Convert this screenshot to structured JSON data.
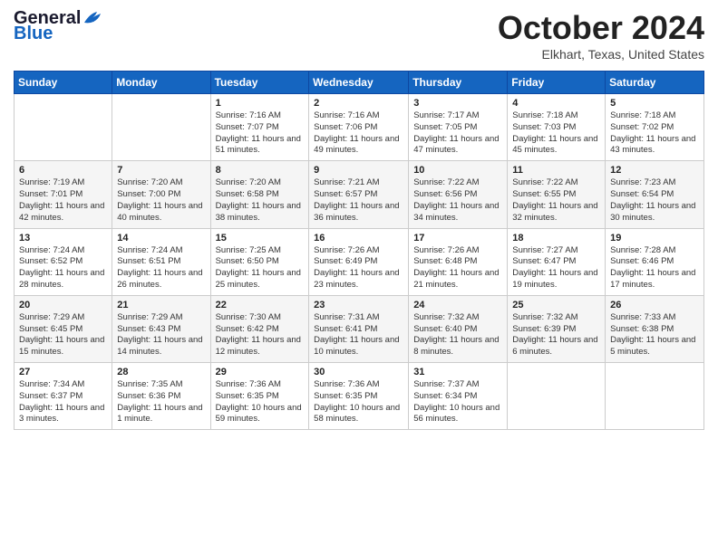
{
  "logo": {
    "line1": "General",
    "line2": "Blue"
  },
  "title": "October 2024",
  "location": "Elkhart, Texas, United States",
  "weekdays": [
    "Sunday",
    "Monday",
    "Tuesday",
    "Wednesday",
    "Thursday",
    "Friday",
    "Saturday"
  ],
  "weeks": [
    [
      {
        "day": "",
        "info": ""
      },
      {
        "day": "",
        "info": ""
      },
      {
        "day": "1",
        "info": "Sunrise: 7:16 AM\nSunset: 7:07 PM\nDaylight: 11 hours and 51 minutes."
      },
      {
        "day": "2",
        "info": "Sunrise: 7:16 AM\nSunset: 7:06 PM\nDaylight: 11 hours and 49 minutes."
      },
      {
        "day": "3",
        "info": "Sunrise: 7:17 AM\nSunset: 7:05 PM\nDaylight: 11 hours and 47 minutes."
      },
      {
        "day": "4",
        "info": "Sunrise: 7:18 AM\nSunset: 7:03 PM\nDaylight: 11 hours and 45 minutes."
      },
      {
        "day": "5",
        "info": "Sunrise: 7:18 AM\nSunset: 7:02 PM\nDaylight: 11 hours and 43 minutes."
      }
    ],
    [
      {
        "day": "6",
        "info": "Sunrise: 7:19 AM\nSunset: 7:01 PM\nDaylight: 11 hours and 42 minutes."
      },
      {
        "day": "7",
        "info": "Sunrise: 7:20 AM\nSunset: 7:00 PM\nDaylight: 11 hours and 40 minutes."
      },
      {
        "day": "8",
        "info": "Sunrise: 7:20 AM\nSunset: 6:58 PM\nDaylight: 11 hours and 38 minutes."
      },
      {
        "day": "9",
        "info": "Sunrise: 7:21 AM\nSunset: 6:57 PM\nDaylight: 11 hours and 36 minutes."
      },
      {
        "day": "10",
        "info": "Sunrise: 7:22 AM\nSunset: 6:56 PM\nDaylight: 11 hours and 34 minutes."
      },
      {
        "day": "11",
        "info": "Sunrise: 7:22 AM\nSunset: 6:55 PM\nDaylight: 11 hours and 32 minutes."
      },
      {
        "day": "12",
        "info": "Sunrise: 7:23 AM\nSunset: 6:54 PM\nDaylight: 11 hours and 30 minutes."
      }
    ],
    [
      {
        "day": "13",
        "info": "Sunrise: 7:24 AM\nSunset: 6:52 PM\nDaylight: 11 hours and 28 minutes."
      },
      {
        "day": "14",
        "info": "Sunrise: 7:24 AM\nSunset: 6:51 PM\nDaylight: 11 hours and 26 minutes."
      },
      {
        "day": "15",
        "info": "Sunrise: 7:25 AM\nSunset: 6:50 PM\nDaylight: 11 hours and 25 minutes."
      },
      {
        "day": "16",
        "info": "Sunrise: 7:26 AM\nSunset: 6:49 PM\nDaylight: 11 hours and 23 minutes."
      },
      {
        "day": "17",
        "info": "Sunrise: 7:26 AM\nSunset: 6:48 PM\nDaylight: 11 hours and 21 minutes."
      },
      {
        "day": "18",
        "info": "Sunrise: 7:27 AM\nSunset: 6:47 PM\nDaylight: 11 hours and 19 minutes."
      },
      {
        "day": "19",
        "info": "Sunrise: 7:28 AM\nSunset: 6:46 PM\nDaylight: 11 hours and 17 minutes."
      }
    ],
    [
      {
        "day": "20",
        "info": "Sunrise: 7:29 AM\nSunset: 6:45 PM\nDaylight: 11 hours and 15 minutes."
      },
      {
        "day": "21",
        "info": "Sunrise: 7:29 AM\nSunset: 6:43 PM\nDaylight: 11 hours and 14 minutes."
      },
      {
        "day": "22",
        "info": "Sunrise: 7:30 AM\nSunset: 6:42 PM\nDaylight: 11 hours and 12 minutes."
      },
      {
        "day": "23",
        "info": "Sunrise: 7:31 AM\nSunset: 6:41 PM\nDaylight: 11 hours and 10 minutes."
      },
      {
        "day": "24",
        "info": "Sunrise: 7:32 AM\nSunset: 6:40 PM\nDaylight: 11 hours and 8 minutes."
      },
      {
        "day": "25",
        "info": "Sunrise: 7:32 AM\nSunset: 6:39 PM\nDaylight: 11 hours and 6 minutes."
      },
      {
        "day": "26",
        "info": "Sunrise: 7:33 AM\nSunset: 6:38 PM\nDaylight: 11 hours and 5 minutes."
      }
    ],
    [
      {
        "day": "27",
        "info": "Sunrise: 7:34 AM\nSunset: 6:37 PM\nDaylight: 11 hours and 3 minutes."
      },
      {
        "day": "28",
        "info": "Sunrise: 7:35 AM\nSunset: 6:36 PM\nDaylight: 11 hours and 1 minute."
      },
      {
        "day": "29",
        "info": "Sunrise: 7:36 AM\nSunset: 6:35 PM\nDaylight: 10 hours and 59 minutes."
      },
      {
        "day": "30",
        "info": "Sunrise: 7:36 AM\nSunset: 6:35 PM\nDaylight: 10 hours and 58 minutes."
      },
      {
        "day": "31",
        "info": "Sunrise: 7:37 AM\nSunset: 6:34 PM\nDaylight: 10 hours and 56 minutes."
      },
      {
        "day": "",
        "info": ""
      },
      {
        "day": "",
        "info": ""
      }
    ]
  ]
}
